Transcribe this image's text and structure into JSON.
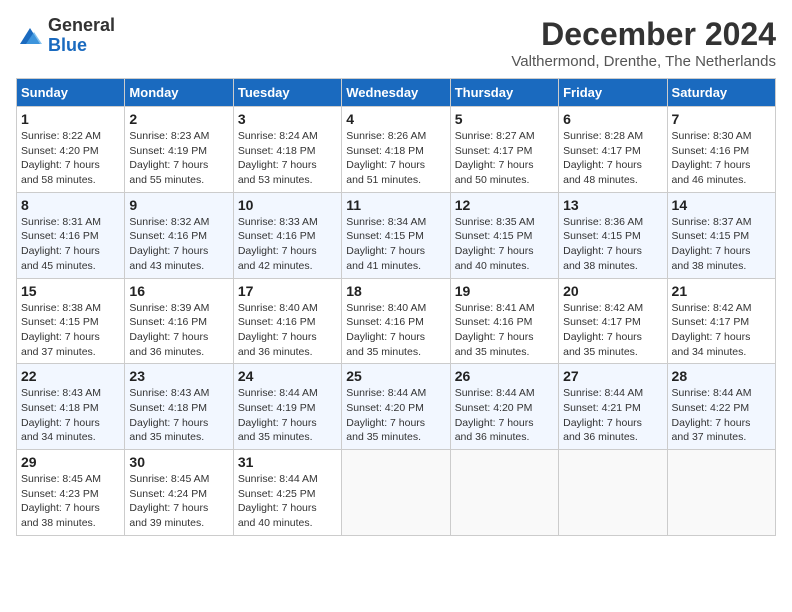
{
  "header": {
    "logo_line1": "General",
    "logo_line2": "Blue",
    "month": "December 2024",
    "location": "Valthermond, Drenthe, The Netherlands"
  },
  "columns": [
    "Sunday",
    "Monday",
    "Tuesday",
    "Wednesday",
    "Thursday",
    "Friday",
    "Saturday"
  ],
  "weeks": [
    [
      {
        "day": "1",
        "text": "Sunrise: 8:22 AM\nSunset: 4:20 PM\nDaylight: 7 hours\nand 58 minutes."
      },
      {
        "day": "2",
        "text": "Sunrise: 8:23 AM\nSunset: 4:19 PM\nDaylight: 7 hours\nand 55 minutes."
      },
      {
        "day": "3",
        "text": "Sunrise: 8:24 AM\nSunset: 4:18 PM\nDaylight: 7 hours\nand 53 minutes."
      },
      {
        "day": "4",
        "text": "Sunrise: 8:26 AM\nSunset: 4:18 PM\nDaylight: 7 hours\nand 51 minutes."
      },
      {
        "day": "5",
        "text": "Sunrise: 8:27 AM\nSunset: 4:17 PM\nDaylight: 7 hours\nand 50 minutes."
      },
      {
        "day": "6",
        "text": "Sunrise: 8:28 AM\nSunset: 4:17 PM\nDaylight: 7 hours\nand 48 minutes."
      },
      {
        "day": "7",
        "text": "Sunrise: 8:30 AM\nSunset: 4:16 PM\nDaylight: 7 hours\nand 46 minutes."
      }
    ],
    [
      {
        "day": "8",
        "text": "Sunrise: 8:31 AM\nSunset: 4:16 PM\nDaylight: 7 hours\nand 45 minutes."
      },
      {
        "day": "9",
        "text": "Sunrise: 8:32 AM\nSunset: 4:16 PM\nDaylight: 7 hours\nand 43 minutes."
      },
      {
        "day": "10",
        "text": "Sunrise: 8:33 AM\nSunset: 4:16 PM\nDaylight: 7 hours\nand 42 minutes."
      },
      {
        "day": "11",
        "text": "Sunrise: 8:34 AM\nSunset: 4:15 PM\nDaylight: 7 hours\nand 41 minutes."
      },
      {
        "day": "12",
        "text": "Sunrise: 8:35 AM\nSunset: 4:15 PM\nDaylight: 7 hours\nand 40 minutes."
      },
      {
        "day": "13",
        "text": "Sunrise: 8:36 AM\nSunset: 4:15 PM\nDaylight: 7 hours\nand 38 minutes."
      },
      {
        "day": "14",
        "text": "Sunrise: 8:37 AM\nSunset: 4:15 PM\nDaylight: 7 hours\nand 38 minutes."
      }
    ],
    [
      {
        "day": "15",
        "text": "Sunrise: 8:38 AM\nSunset: 4:15 PM\nDaylight: 7 hours\nand 37 minutes."
      },
      {
        "day": "16",
        "text": "Sunrise: 8:39 AM\nSunset: 4:16 PM\nDaylight: 7 hours\nand 36 minutes."
      },
      {
        "day": "17",
        "text": "Sunrise: 8:40 AM\nSunset: 4:16 PM\nDaylight: 7 hours\nand 36 minutes."
      },
      {
        "day": "18",
        "text": "Sunrise: 8:40 AM\nSunset: 4:16 PM\nDaylight: 7 hours\nand 35 minutes."
      },
      {
        "day": "19",
        "text": "Sunrise: 8:41 AM\nSunset: 4:16 PM\nDaylight: 7 hours\nand 35 minutes."
      },
      {
        "day": "20",
        "text": "Sunrise: 8:42 AM\nSunset: 4:17 PM\nDaylight: 7 hours\nand 35 minutes."
      },
      {
        "day": "21",
        "text": "Sunrise: 8:42 AM\nSunset: 4:17 PM\nDaylight: 7 hours\nand 34 minutes."
      }
    ],
    [
      {
        "day": "22",
        "text": "Sunrise: 8:43 AM\nSunset: 4:18 PM\nDaylight: 7 hours\nand 34 minutes."
      },
      {
        "day": "23",
        "text": "Sunrise: 8:43 AM\nSunset: 4:18 PM\nDaylight: 7 hours\nand 35 minutes."
      },
      {
        "day": "24",
        "text": "Sunrise: 8:44 AM\nSunset: 4:19 PM\nDaylight: 7 hours\nand 35 minutes."
      },
      {
        "day": "25",
        "text": "Sunrise: 8:44 AM\nSunset: 4:20 PM\nDaylight: 7 hours\nand 35 minutes."
      },
      {
        "day": "26",
        "text": "Sunrise: 8:44 AM\nSunset: 4:20 PM\nDaylight: 7 hours\nand 36 minutes."
      },
      {
        "day": "27",
        "text": "Sunrise: 8:44 AM\nSunset: 4:21 PM\nDaylight: 7 hours\nand 36 minutes."
      },
      {
        "day": "28",
        "text": "Sunrise: 8:44 AM\nSunset: 4:22 PM\nDaylight: 7 hours\nand 37 minutes."
      }
    ],
    [
      {
        "day": "29",
        "text": "Sunrise: 8:45 AM\nSunset: 4:23 PM\nDaylight: 7 hours\nand 38 minutes."
      },
      {
        "day": "30",
        "text": "Sunrise: 8:45 AM\nSunset: 4:24 PM\nDaylight: 7 hours\nand 39 minutes."
      },
      {
        "day": "31",
        "text": "Sunrise: 8:44 AM\nSunset: 4:25 PM\nDaylight: 7 hours\nand 40 minutes."
      },
      {
        "day": "",
        "text": ""
      },
      {
        "day": "",
        "text": ""
      },
      {
        "day": "",
        "text": ""
      },
      {
        "day": "",
        "text": ""
      }
    ]
  ]
}
